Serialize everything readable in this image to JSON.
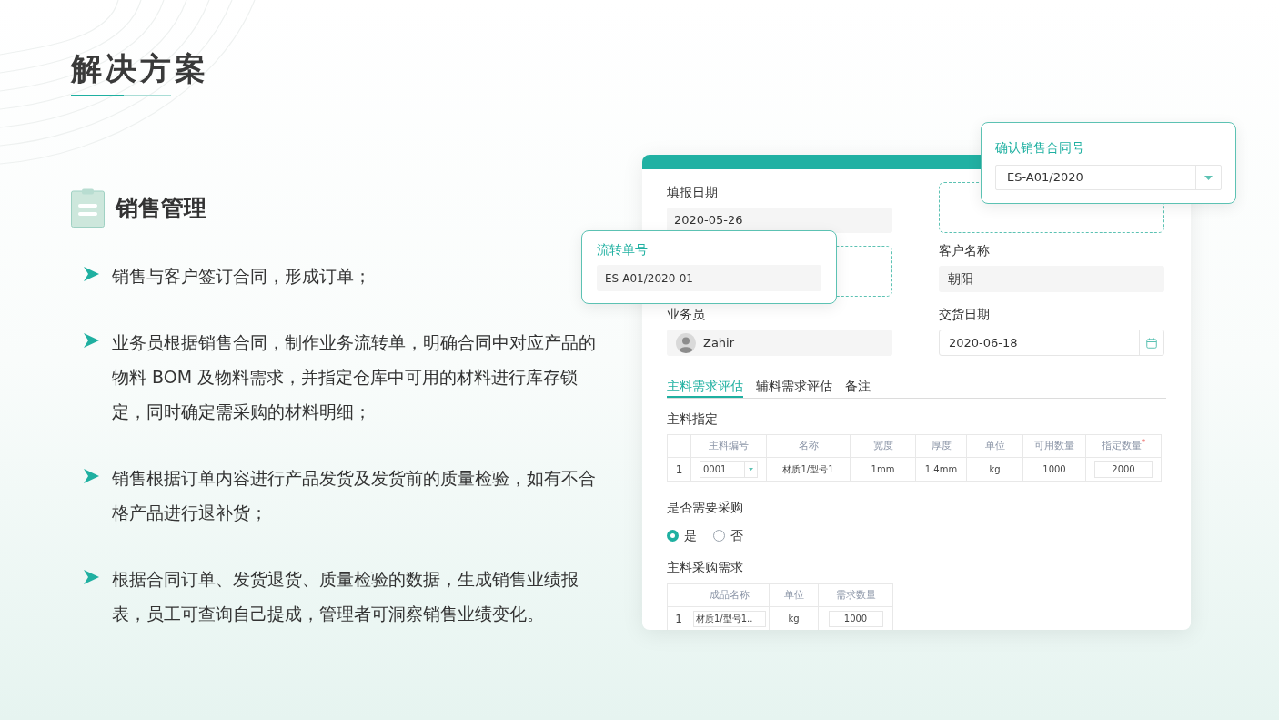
{
  "slide": {
    "title": "解决方案"
  },
  "section": {
    "heading": "销售管理",
    "bullets": [
      "销售与客户签订合同，形成订单；",
      "业务员根据销售合同，制作业务流转单，明确合同中对应产品的物料 BOM 及物料需求，并指定仓库中可用的材料进行库存锁定，同时确定需采购的材料明细；",
      "销售根据订单内容进行产品发货及发货前的质量检验，如有不合格产品进行退补货；",
      "根据合同订单、发货退货、质量检验的数据，生成销售业绩报表，员工可查询自己提成，管理者可洞察销售业绩变化。"
    ]
  },
  "form": {
    "report_date": {
      "label": "填报日期",
      "value": "2020-05-26"
    },
    "customer": {
      "label": "客户名称",
      "value": "朝阳"
    },
    "salesperson": {
      "label": "业务员",
      "value": "Zahir"
    },
    "delivery_date": {
      "label": "交货日期",
      "value": "2020-06-18"
    },
    "tabs": [
      {
        "label": "主料需求评估",
        "selected": true
      },
      {
        "label": "辅料需求评估",
        "selected": false
      },
      {
        "label": "备注",
        "selected": false
      }
    ],
    "material_table": {
      "title": "主料指定",
      "columns": [
        {
          "label": "主料编号"
        },
        {
          "label": "名称"
        },
        {
          "label": "宽度"
        },
        {
          "label": "厚度"
        },
        {
          "label": "单位"
        },
        {
          "label": "可用数量"
        },
        {
          "label": "指定数量",
          "mark": "*"
        }
      ],
      "rows": [
        {
          "index": "1",
          "code": "0001",
          "name": "材质1/型号1",
          "width": "1mm",
          "thickness": "1.4mm",
          "unit": "kg",
          "available": "1000",
          "assigned": "2000"
        }
      ]
    },
    "purchase_question": {
      "label": "是否需要采购",
      "options": [
        {
          "label": "是",
          "selected": true
        },
        {
          "label": "否",
          "selected": false
        }
      ]
    },
    "purchase_table": {
      "title": "主料采购需求",
      "columns": [
        {
          "label": "成品名称"
        },
        {
          "label": "单位"
        },
        {
          "label": "需求数量"
        }
      ],
      "rows": [
        {
          "index": "1",
          "product": "材质1/型号1..",
          "unit": "kg",
          "quantity": "1000"
        }
      ]
    }
  },
  "popups": {
    "transfer_no": {
      "label": "流转单号",
      "value": "ES-A01/2020-01"
    },
    "contract_no": {
      "label": "确认销售合同号",
      "value": "ES-A01/2020"
    }
  }
}
